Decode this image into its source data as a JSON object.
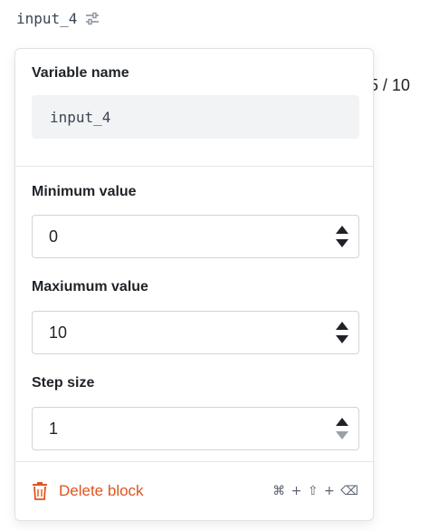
{
  "header": {
    "variable_chip": "input_4"
  },
  "behind": {
    "partial_text": "5 / 10"
  },
  "popover": {
    "variable_name_label": "Variable name",
    "variable_name_value": "input_4",
    "minimum": {
      "label": "Minimum value",
      "value": "0"
    },
    "maximum": {
      "label": "Maxiumum value",
      "value": "10"
    },
    "step": {
      "label": "Step size",
      "value": "1"
    },
    "delete": {
      "label": "Delete block",
      "shortcut": "⌘ + ⇧ + ⌫"
    }
  },
  "colors": {
    "accent_delete": "#e0541f",
    "border": "#cfd4da",
    "panel_bg": "#f2f3f5"
  }
}
